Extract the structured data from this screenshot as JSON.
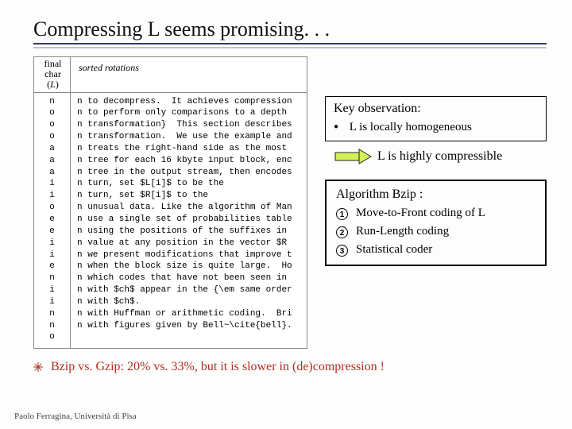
{
  "title": "Compressing L seems promising. . .",
  "figure": {
    "head_col1_line1": "final",
    "head_col1_line2": "char",
    "head_col1_line3": "(L)",
    "head_col2": "sorted rotations",
    "chars": "n\no\no\no\na\na\na\ni\ni\no\ne\ne\ni\ni\ne\nn\ni\ni\nn\nn\no",
    "rotations": "n to decompress.  It achieves compression\nn to perform only comparisons to a depth\nn transformation}  This section describes\nn transformation.  We use the example and\nn treats the right-hand side as the most\nn tree for each 16 kbyte input block, enc\nn tree in the output stream, then encodes\nn turn, set $L[i]$ to be the\nn turn, set $R[i]$ to the\nn unusual data. Like the algorithm of Man\nn use a single set of probabilities table\nn using the positions of the suffixes in\nn value at any position in the vector $R\nn we present modifications that improve t\nn when the block size is quite large.  Ho\nn which codes that have not been seen in\nn with $ch$ appear in the {\\em same order\nn with $ch$.\nn with Huffman or arithmetic coding.  Bri\nn with figures given by Bell~\\cite{bell}."
  },
  "observation": {
    "title": "Key observation:",
    "bullet": "L is locally homogeneous",
    "conclusion": "L is highly compressible"
  },
  "algorithm": {
    "title": "Algorithm Bzip :",
    "step1": "Move-to-Front coding of L",
    "step2": "Run-Length coding",
    "step3": "Statistical coder"
  },
  "bottom": "Bzip vs. Gzip: 20% vs. 33%, but it is slower in (de)compression !",
  "footer": "Paolo Ferragina, Università di Pisa"
}
